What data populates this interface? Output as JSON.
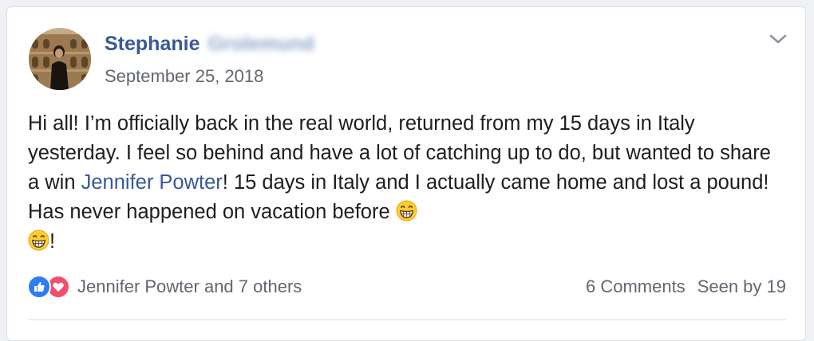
{
  "post": {
    "author_first": "Stephanie",
    "author_last": "Grolemund",
    "timestamp": "September 25, 2018",
    "body_part1": "Hi all! I’m officially back in the real world, returned from my 15 days in Italy yesterday. I feel so behind and have a lot of catching up to do, but wanted to share a win ",
    "mention": "Jennifer Powter",
    "body_part2": "! 15 days in Italy and I actually came home and lost a pound! Has never happened on vacation before ",
    "body_part3": "!",
    "emoji_name": "grinning-face-icon"
  },
  "reactions": {
    "icons": [
      "like-icon",
      "love-icon"
    ],
    "summary": "Jennifer Powter and 7 others"
  },
  "stats": {
    "comments": "6 Comments",
    "seen": "Seen by 19"
  },
  "colors": {
    "link": "#385898",
    "text": "#1c1e21",
    "secondary": "#606770",
    "like": "#2f7cf6",
    "love": "#f0506e"
  }
}
